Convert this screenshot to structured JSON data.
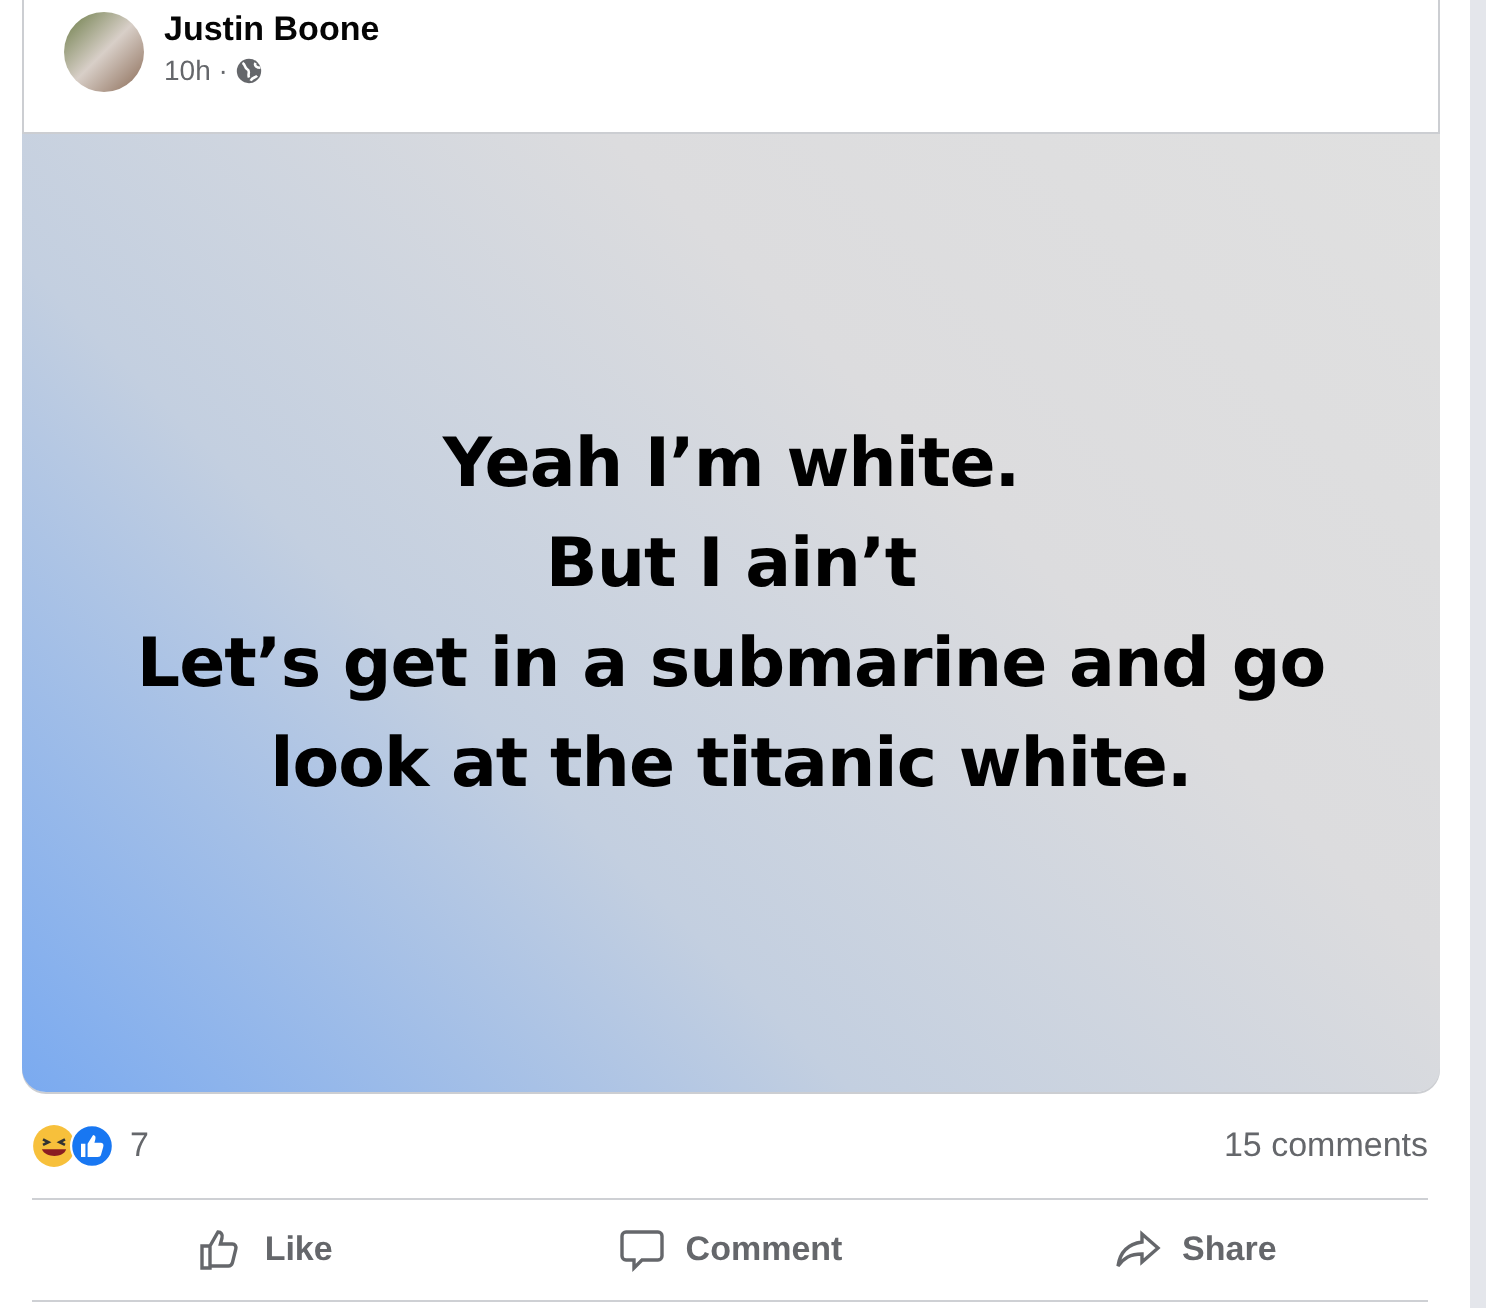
{
  "post": {
    "author": "Justin Boone",
    "time": "10h ·",
    "text_lines": [
      "Yeah I’m white.",
      "But I ain’t",
      "Let’s get in a submarine and go",
      "look at the titanic white."
    ],
    "reaction_count": "7",
    "comments": "15 comments",
    "actions": [
      {
        "kind": "like",
        "label": "Like"
      },
      {
        "kind": "comment",
        "label": "Comment"
      },
      {
        "kind": "share",
        "label": "Share"
      }
    ]
  }
}
